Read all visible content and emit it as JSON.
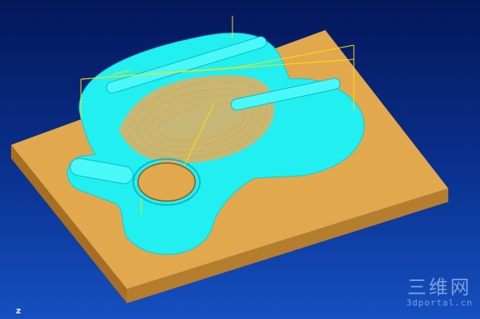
{
  "viewport": {
    "axis_label": "z",
    "watermark": {
      "title": "三维网",
      "subtitle": "3dportal.cn"
    }
  },
  "colors": {
    "background_top": "#04175a",
    "background_bottom": "#1550c0",
    "stock_top": "#e2a84e",
    "stock_side": "#b57d2e",
    "toolpath_cyan": "#22f0f0",
    "toolpath_orange": "#f0a020",
    "retract_yellow": "#ffe000"
  },
  "icons": {
    "axis": "axis-triad-icon",
    "logo": "watermark-logo-icon"
  }
}
